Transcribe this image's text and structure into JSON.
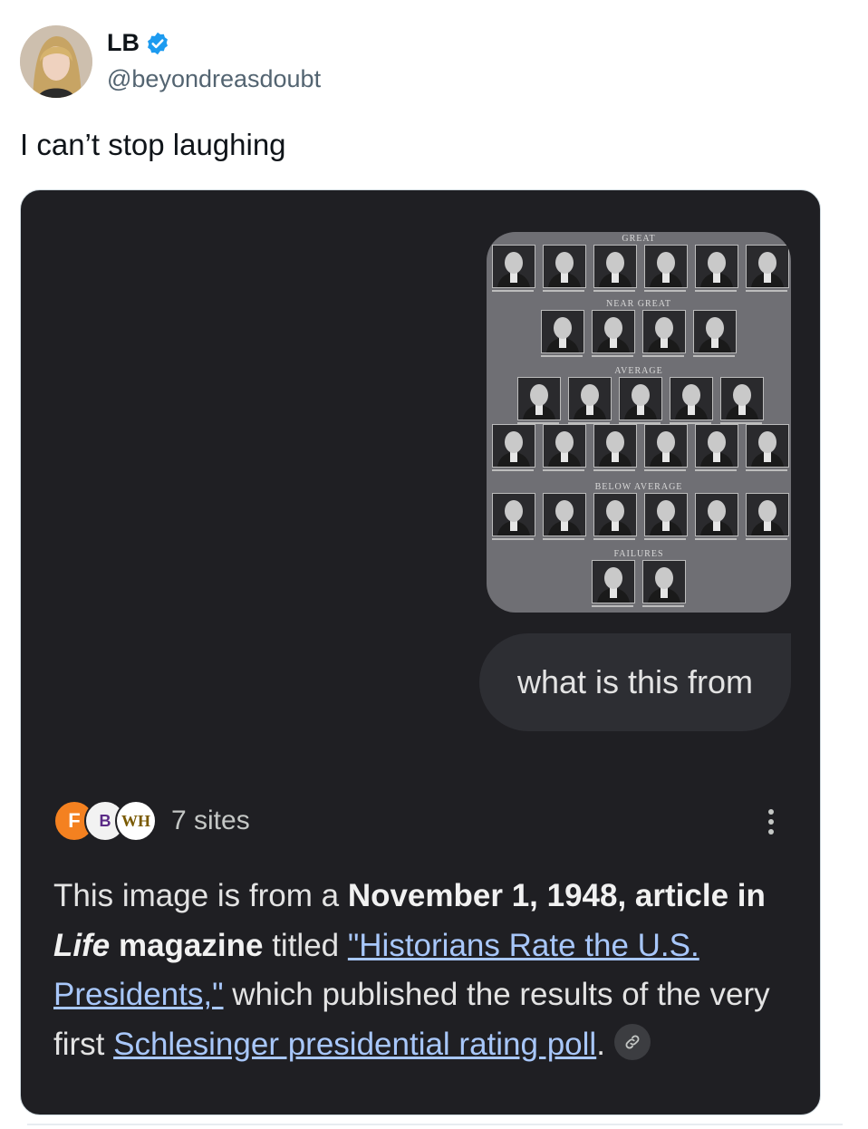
{
  "author": {
    "name": "LB",
    "handle": "@beyondreasdoubt",
    "verified": true
  },
  "tweet": {
    "text": "I can’t stop laughing"
  },
  "screenshot": {
    "photo": {
      "tiers": [
        "GREAT",
        "NEAR GREAT",
        "AVERAGE",
        "BELOW AVERAGE",
        "FAILURES"
      ]
    },
    "query": "what is this from",
    "sources": {
      "icons": [
        "F",
        "B",
        "WH"
      ],
      "count_label": "7 sites"
    },
    "answer": {
      "p1": "This image is from a ",
      "b1": "November 1, 1948, article in ",
      "b1_italic": "Life",
      "b1_end": " magazine",
      "p2": " titled ",
      "link1": "\"Historians Rate the U.S. Presidents,\"",
      "p3": " which published the results of the very first ",
      "link2": "Schlesinger presidential rating poll",
      "p4": "."
    }
  },
  "colors": {
    "card_bg": "#1f1f23",
    "link": "#a8c7fa",
    "verified_badge": "#1d9bf0"
  }
}
